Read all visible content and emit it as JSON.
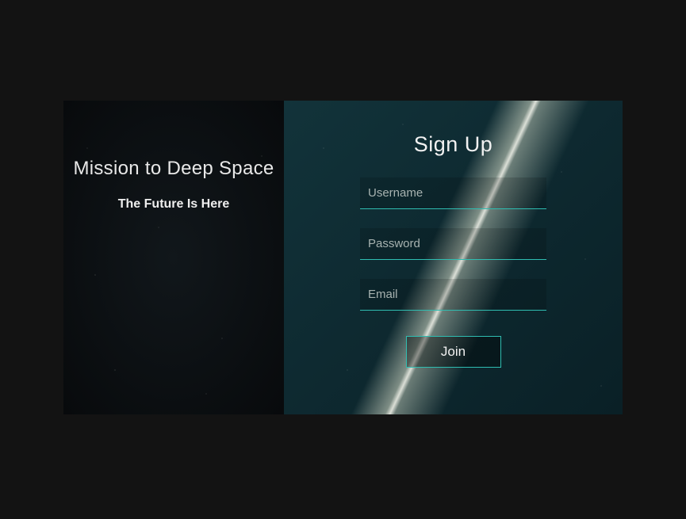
{
  "hero": {
    "title": "Mission to Deep Space",
    "subtitle": "The Future Is Here"
  },
  "form": {
    "heading": "Sign Up",
    "username_placeholder": "Username",
    "password_placeholder": "Password",
    "email_placeholder": "Email",
    "submit_label": "Join"
  },
  "colors": {
    "accent": "#2fbdb1"
  }
}
